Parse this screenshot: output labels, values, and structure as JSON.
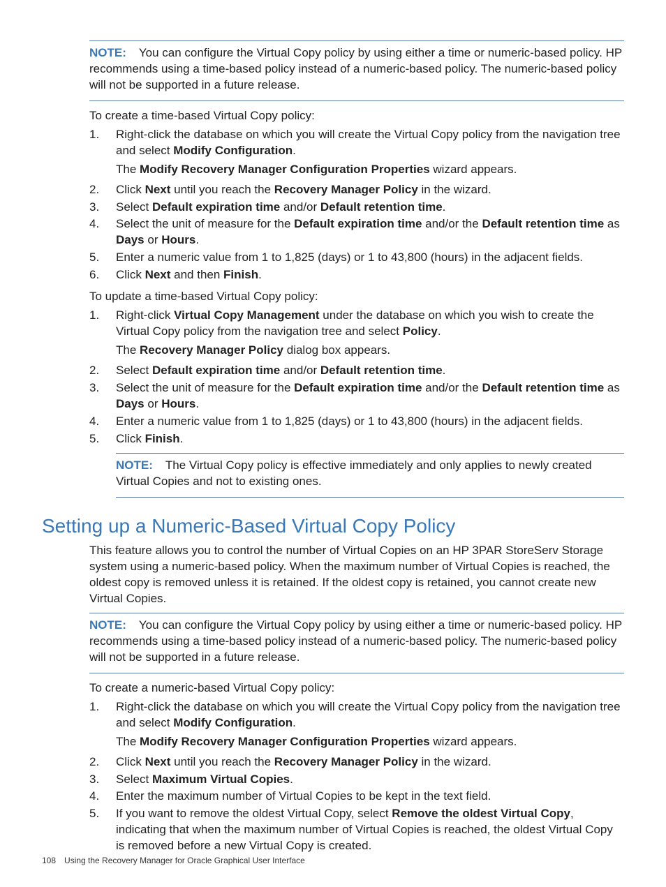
{
  "note1": {
    "label": "NOTE:",
    "text": "You can configure the Virtual Copy policy by using either a time or numeric-based policy. HP recommends using a time-based policy instead of a numeric-based policy. The numeric-based policy will not be supported in a future release."
  },
  "p_create_time": "To create a time-based Virtual Copy policy:",
  "steps_create_time": {
    "n1": "1.",
    "s1a": "Right-click the database on which you will create the Virtual Copy policy from the navigation tree and select ",
    "s1b": "Modify Configuration",
    "s1c": ".",
    "s1d_a": "The ",
    "s1d_b": "Modify Recovery Manager Configuration Properties",
    "s1d_c": " wizard appears.",
    "n2": "2.",
    "s2a": "Click ",
    "s2b": "Next",
    "s2c": " until you reach the ",
    "s2d": "Recovery Manager Policy",
    "s2e": " in the wizard.",
    "n3": "3.",
    "s3a": "Select ",
    "s3b": "Default expiration time",
    "s3c": " and/or ",
    "s3d": "Default retention time",
    "s3e": ".",
    "n4": "4.",
    "s4a": "Select the unit of measure for the ",
    "s4b": "Default expiration time",
    "s4c": " and/or the ",
    "s4d": "Default retention time",
    "s4e": " as ",
    "s4f": "Days",
    "s4g": " or ",
    "s4h": "Hours",
    "s4i": ".",
    "n5": "5.",
    "s5": "Enter a numeric value from 1 to 1,825 (days) or 1 to 43,800 (hours) in the adjacent fields.",
    "n6": "6.",
    "s6a": "Click ",
    "s6b": "Next",
    "s6c": " and then ",
    "s6d": "Finish",
    "s6e": "."
  },
  "p_update_time": "To update a time-based Virtual Copy policy:",
  "steps_update_time": {
    "n1": "1.",
    "s1a": "Right-click ",
    "s1b": "Virtual Copy Management",
    "s1c": " under the database on which you wish to create the Virtual Copy policy from the navigation tree and select ",
    "s1d": "Policy",
    "s1e": ".",
    "s1f_a": "The ",
    "s1f_b": "Recovery Manager Policy",
    "s1f_c": " dialog box appears.",
    "n2": "2.",
    "s2a": "Select ",
    "s2b": "Default expiration time",
    "s2c": " and/or ",
    "s2d": "Default retention time",
    "s2e": ".",
    "n3": "3.",
    "s3a": "Select the unit of measure for the ",
    "s3b": "Default expiration time",
    "s3c": " and/or the ",
    "s3d": "Default retention time",
    "s3e": " as ",
    "s3f": "Days",
    "s3g": " or ",
    "s3h": "Hours",
    "s3i": ".",
    "n4": "4.",
    "s4": "Enter a numeric value from 1 to 1,825 (days) or 1 to 43,800 (hours) in the adjacent fields.",
    "n5": "5.",
    "s5a": "Click ",
    "s5b": "Finish",
    "s5c": "."
  },
  "note2": {
    "label": "NOTE:",
    "text": "The Virtual Copy policy is effective immediately and only applies to newly created Virtual Copies and not to existing ones."
  },
  "section_heading": "Setting up a Numeric-Based Virtual Copy Policy",
  "p_numeric_intro": "This feature allows you to control the number of Virtual Copies on an HP 3PAR StoreServ Storage system using a numeric-based policy. When the maximum number of Virtual Copies is reached, the oldest copy is removed unless it is retained. If the oldest copy is retained, you cannot create new Virtual Copies.",
  "note3": {
    "label": "NOTE:",
    "text": "You can configure the Virtual Copy policy by using either a time or numeric-based policy. HP recommends using a time-based policy instead of a numeric-based policy. The numeric-based policy will not be supported in a future release."
  },
  "p_create_numeric": "To create a numeric-based Virtual Copy policy:",
  "steps_create_numeric": {
    "n1": "1.",
    "s1a": "Right-click the database on which you will create the Virtual Copy policy from the navigation tree and select ",
    "s1b": "Modify Configuration",
    "s1c": ".",
    "s1d_a": "The ",
    "s1d_b": "Modify Recovery Manager Configuration Properties",
    "s1d_c": " wizard appears.",
    "n2": "2.",
    "s2a": "Click ",
    "s2b": "Next",
    "s2c": " until you reach the ",
    "s2d": "Recovery Manager Policy",
    "s2e": " in the wizard.",
    "n3": "3.",
    "s3a": "Select ",
    "s3b": "Maximum Virtual Copies",
    "s3c": ".",
    "n4": "4.",
    "s4": "Enter the maximum number of Virtual Copies to be kept in the text field.",
    "n5": "5.",
    "s5a": "If you want to remove the oldest Virtual Copy, select ",
    "s5b": "Remove the oldest Virtual Copy",
    "s5c": ", indicating that when the maximum number of Virtual Copies is reached, the oldest Virtual Copy is removed before a new Virtual Copy is created."
  },
  "footer": {
    "page": "108",
    "text": "Using the Recovery Manager for Oracle Graphical User Interface"
  }
}
